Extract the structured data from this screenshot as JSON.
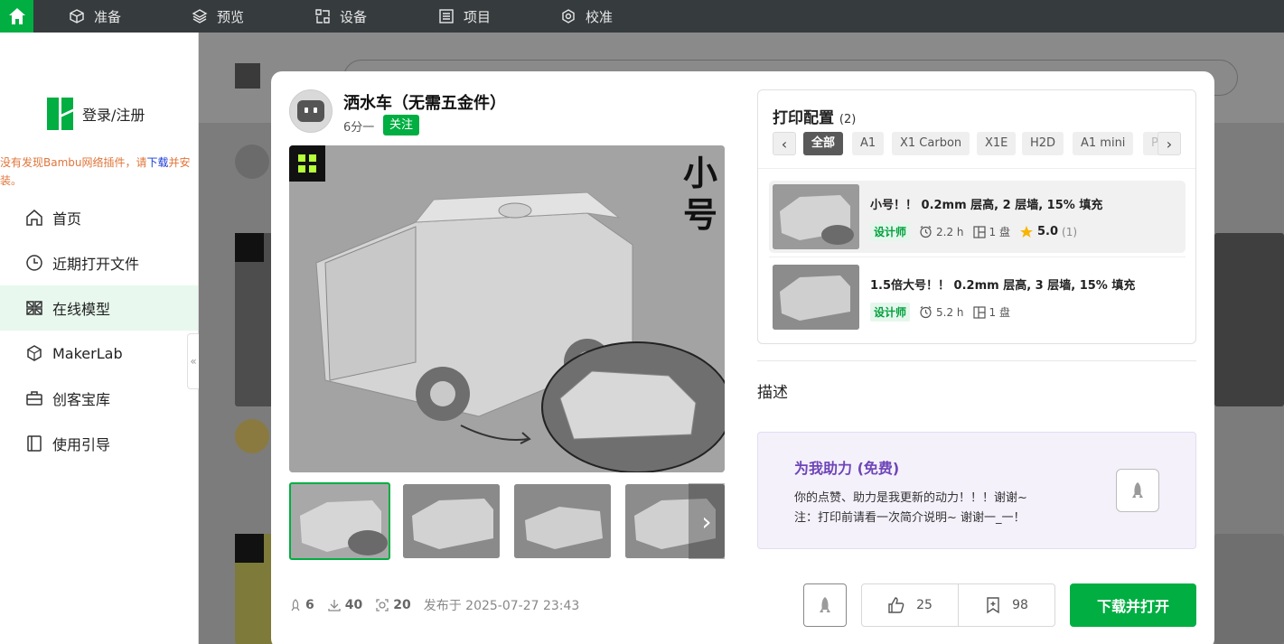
{
  "topbar": {
    "items": [
      {
        "label": "准备",
        "icon": "cube-icon"
      },
      {
        "label": "预览",
        "icon": "layers-icon"
      },
      {
        "label": "设备",
        "icon": "device-icon"
      },
      {
        "label": "项目",
        "icon": "project-icon"
      },
      {
        "label": "校准",
        "icon": "gear-icon"
      }
    ],
    "accent": "#00ae42",
    "background": "#363b3e"
  },
  "sidebar": {
    "login_label": "登录/注册",
    "warning": {
      "text_before": "没有发现Bambu网络插件，请",
      "link": "下载",
      "text_after": "并安装。"
    },
    "items": [
      {
        "label": "首页",
        "icon": "home-icon"
      },
      {
        "label": "近期打开文件",
        "icon": "clock-icon"
      },
      {
        "label": "在线模型",
        "icon": "models-icon",
        "active": true
      },
      {
        "label": "MakerLab",
        "icon": "makerlab-icon"
      },
      {
        "label": "创客宝库",
        "icon": "toolbox-icon"
      },
      {
        "label": "使用引导",
        "icon": "book-icon"
      }
    ],
    "collapse_glyph": "«"
  },
  "model": {
    "title": "洒水车（无需五金件）",
    "author": "6分一",
    "follow_label": "关注",
    "image_label": "小号",
    "thumbnails": 4,
    "stats": {
      "boosts": "6",
      "downloads": "40",
      "prints": "20",
      "published": "发布于 2025-07-27 23:43"
    }
  },
  "print_config": {
    "title": "打印配置",
    "count": "(2)",
    "tabs": [
      "全部",
      "A1",
      "X1 Carbon",
      "X1E",
      "H2D",
      "A1 mini",
      "P"
    ],
    "active_tab": "全部",
    "plates": [
      {
        "name": "小号！！ 0.2mm 层高, 2 层墙, 15% 填充",
        "badge": "设计师",
        "time": "2.2 h",
        "plates": "1 盘",
        "rating": "5.0",
        "rating_count": "(1)"
      },
      {
        "name": "1.5倍大号！！ 0.2mm 层高, 3 层墙, 15% 填充",
        "badge": "设计师",
        "time": "5.2 h",
        "plates": "1 盘"
      }
    ]
  },
  "description": {
    "label": "描述"
  },
  "boost_panel": {
    "title": "为我助力 (免费)",
    "line1": "你的点赞、助力是我更新的动力！！！谢谢~",
    "line2": "注：打印前请看一次简介说明~ 谢谢一_一！"
  },
  "actions": {
    "likes": "25",
    "collects": "98",
    "download_label": "下载并打开"
  }
}
